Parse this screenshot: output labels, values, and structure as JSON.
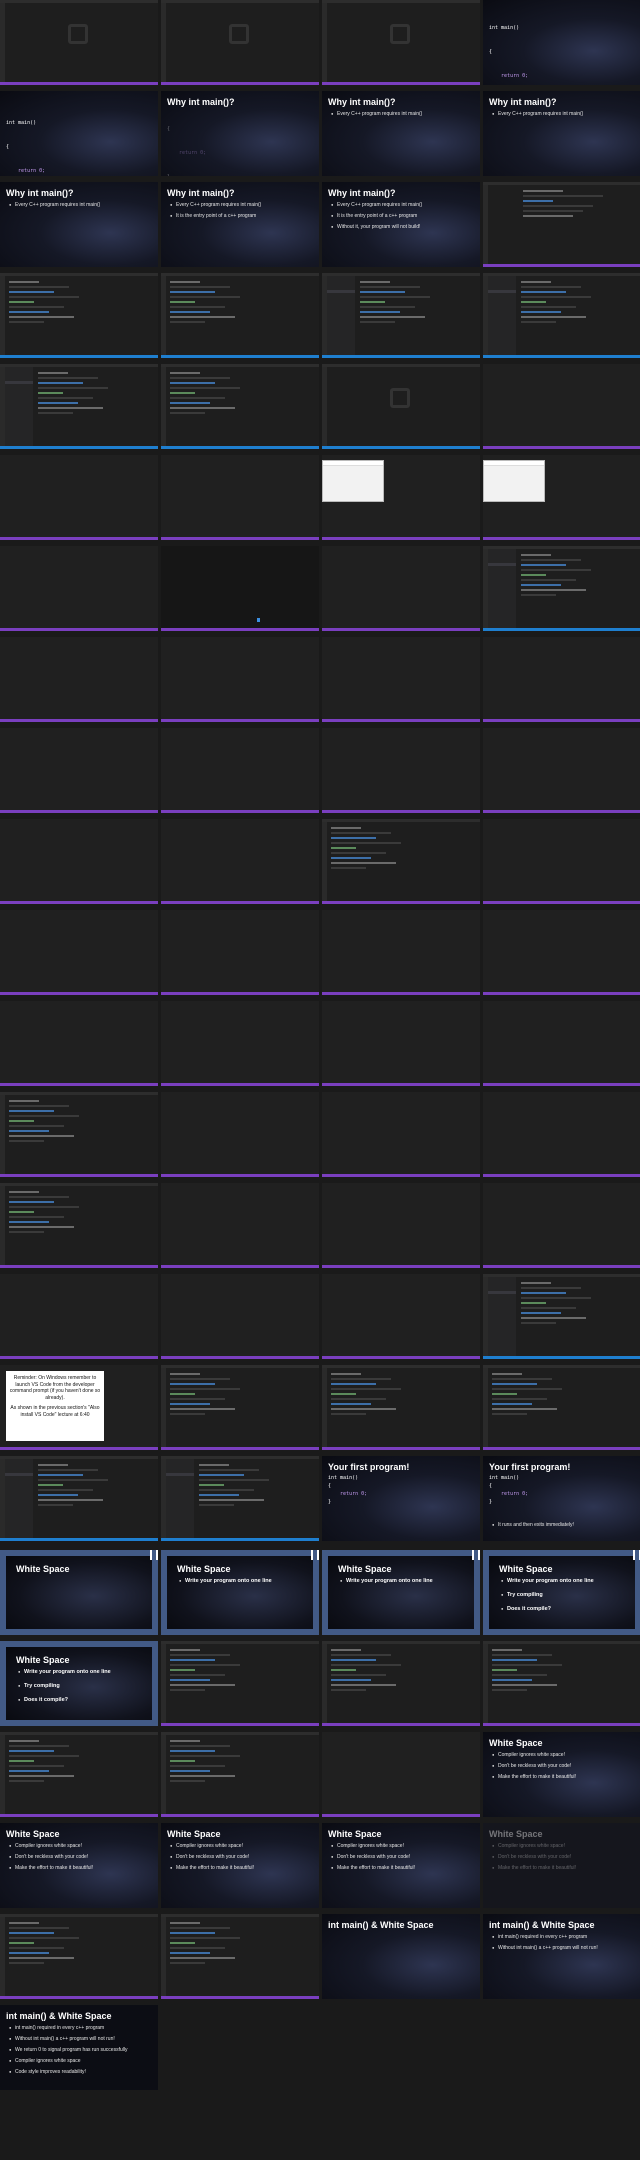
{
  "slides": {
    "code_main": [
      "int main()",
      "{",
      "    return 0;",
      "}"
    ],
    "why_title": "Why int main()?",
    "why_b1": "Every C++ program requires int main()",
    "why_b2": "It is the entry point of a c++ program",
    "why_b3": "Without it, your program will not build!",
    "reminder_p1": "Reminder: On Windows remember to launch VS Code from the developer command prompt (if you haven't done so already).",
    "reminder_p2": "As shown in the previous section's \"Also install VS Code\" lecture at 6:40",
    "first_title": "Your first program!",
    "first_note": "It runs and then exits immediately!",
    "ws_title": "White Space",
    "ws_b1": "Write your program onto one line",
    "ws_b2": "Try compiling",
    "ws_b3": "Does it compile?",
    "ws2_b1": "Compiler ignores white space!",
    "ws2_b2": "Don't be reckless with your code!",
    "ws2_b3": "Make the effort to make it beautiful!",
    "final_title": "int main() & White Space",
    "final_b1": "int main() required in every c++ program",
    "final_b2": "Without int main() a c++ program will not run!",
    "final_b3": "We return 0 to signal program has run successfully",
    "final_b4": "Compiler ignores white space",
    "final_b5": "Code style improves readability!"
  },
  "colors": {
    "editor_bg": "#1e1e1e",
    "status_purple": "#7a3fbf",
    "status_blue": "#1f7fcf",
    "ws_frame": "#425a86"
  }
}
